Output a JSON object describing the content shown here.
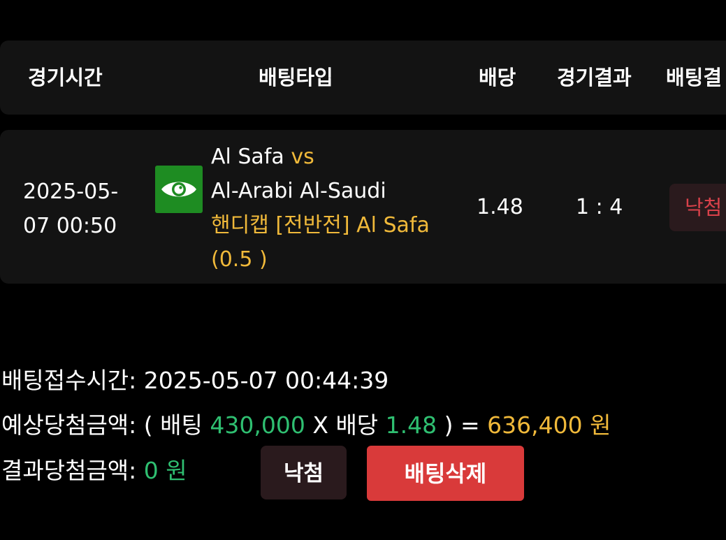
{
  "header": {
    "col_time": "경기시간",
    "col_type": "배팅타입",
    "col_odds": "배당",
    "col_game_result": "경기결과",
    "col_bet_result": "배팅결"
  },
  "row": {
    "time_line1": "2025-05-",
    "time_line2": "07 00:50",
    "icon": "eye-icon",
    "home_team": "Al Safa",
    "vs": "vs",
    "away_team": "Al-Arabi Al-Saudi",
    "bet_type": "핸디캡 [전반전] Al Safa",
    "bet_line": "(0.5 )",
    "odds": "1.48",
    "score": "1 : 4",
    "result": "낙첨"
  },
  "info": {
    "received_label": "배팅접수시간:",
    "received_value": "2025-05-07 00:44:39",
    "expected_label": "예상당첨금액:",
    "expected_open": "( 배팅",
    "expected_stake": "430,000",
    "expected_x": "X 배당",
    "expected_odds": "1.48",
    "expected_close": ") =",
    "expected_payout": "636,400",
    "expected_unit": "원",
    "result_label": "결과당첨금액:",
    "result_value": "0 원"
  },
  "buttons": {
    "lose_label": "낙첨",
    "delete_label": "배팅삭제"
  },
  "colors": {
    "accent_yellow": "#f0b93a",
    "accent_green": "#2fbf71",
    "danger_red": "#d93a3a",
    "icon_green": "#1e8c22"
  }
}
